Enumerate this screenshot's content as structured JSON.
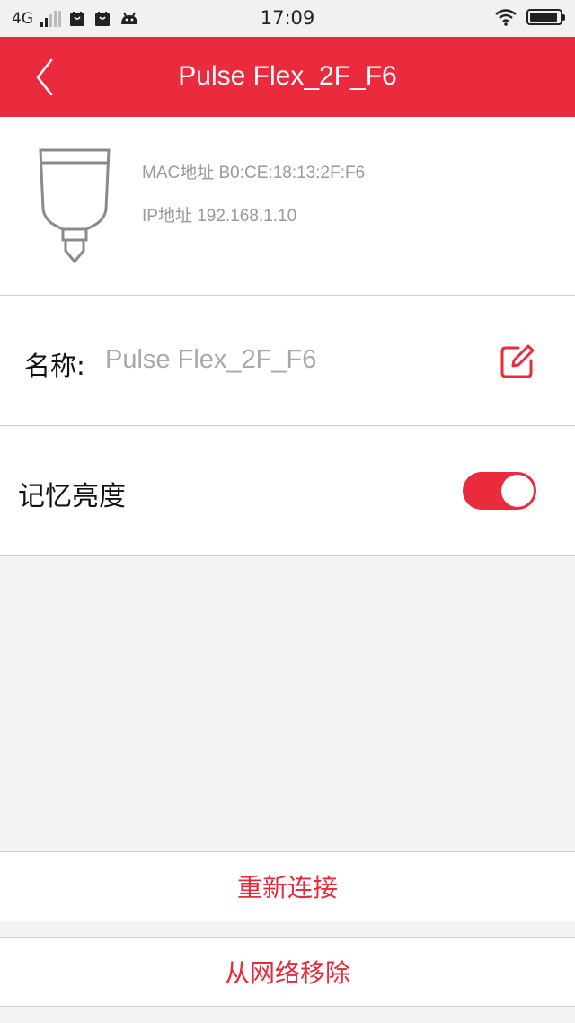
{
  "status_bar": {
    "network": "4G",
    "time": "17:09",
    "icons": [
      "signal-icon",
      "bag-icon",
      "bag-icon",
      "android-icon",
      "wifi-icon",
      "battery-icon"
    ],
    "battery_level": 0.95
  },
  "header": {
    "title": "Pulse Flex_2F_F6",
    "back_icon": "chevron-left-icon",
    "background": "#ea2a3d"
  },
  "device": {
    "icon": "bulb-icon",
    "mac": "MAC地址 B0:CE:18:13:2F:F6",
    "ip": "IP地址 192.168.1.10"
  },
  "name_row": {
    "label": "名称:",
    "value": "Pulse Flex_2F_F6",
    "edit_icon": "edit-icon"
  },
  "memory_row": {
    "label": "记忆亮度",
    "enabled": true
  },
  "actions": {
    "reconnect": "重新连接",
    "remove": "从网络移除"
  },
  "colors": {
    "accent": "#ea2a3d",
    "background": "#f3f3f3",
    "secondary_text": "#9a9a9a"
  }
}
